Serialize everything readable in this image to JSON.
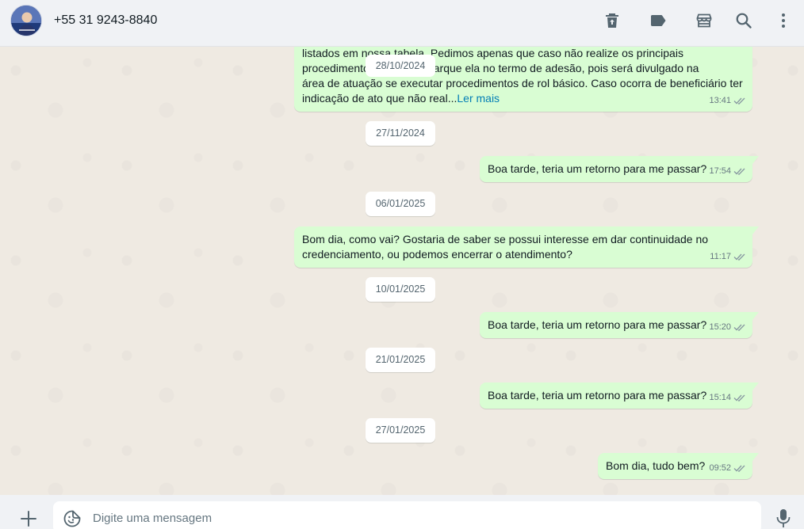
{
  "header": {
    "contact_name": "+55 31 9243-8840",
    "icons": [
      "trash-icon",
      "label-icon",
      "store-icon",
      "search-icon",
      "menu-icon"
    ]
  },
  "messages": [
    {
      "lines": [
        "listados em nossa tabela. Pedimos apenas que caso não realize os principais",
        "procedimentos, que não marque ela no termo de adesão, pois será divulgado na",
        "área de atuação se executar procedimentos de rol básico. Caso ocorra de beneficiário ter",
        "indicação de ato que não real..."
      ],
      "read_more": "Ler mais",
      "time": "13:41"
    },
    {
      "text": "Boa tarde, teria um retorno para me passar?",
      "time": "17:54"
    },
    {
      "lines": [
        "Bom dia, como vai? Gostaria de saber se possui interesse em dar continuidade no",
        "credenciamento, ou podemos encerrar o atendimento?"
      ],
      "time": "11:17"
    },
    {
      "text": "Boa tarde, teria um retorno para me passar?",
      "time": "15:20"
    },
    {
      "text": "Boa tarde, teria um retorno para me passar?",
      "time": "15:14"
    },
    {
      "text": "Bom dia, tudo bem?",
      "time": "09:52"
    }
  ],
  "dates": [
    "28/10/2024",
    "27/11/2024",
    "06/01/2025",
    "10/01/2025",
    "21/01/2025",
    "27/01/2025"
  ],
  "composer": {
    "placeholder": "Digite uma mensagem"
  },
  "colors": {
    "outgoing_bubble": "#d9fdd3",
    "chat_background": "#efeae2",
    "header_background": "#f0f2f5",
    "link": "#027eb5",
    "tick": "#8696a0"
  }
}
